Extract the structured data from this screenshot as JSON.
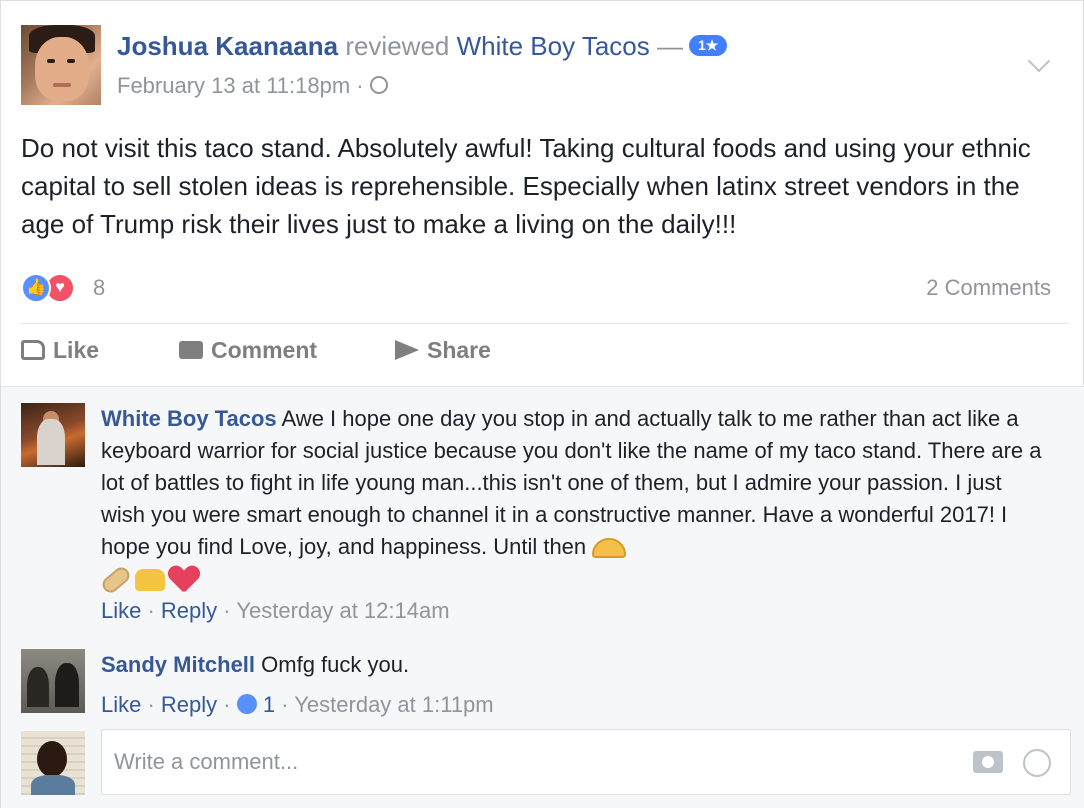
{
  "post": {
    "author": "Joshua Kaanaana",
    "action": " reviewed ",
    "page": "White Boy Tacos",
    "dash": " —",
    "rating_badge": "1★",
    "timestamp": "February 13 at 11:18pm",
    "dot": " · ",
    "text": "Do not visit this taco stand. Absolutely awful! Taking cultural foods and using your ethnic capital to sell stolen ideas is reprehensible. Especially when latinx street vendors in the age of Trump risk their lives just to make a living on the daily!!!",
    "reaction_count": "8",
    "comments_count": "2 Comments"
  },
  "actions": {
    "like": "Like",
    "comment": "Comment",
    "share": "Share"
  },
  "comments": [
    {
      "author": "White Boy Tacos",
      "text": " Awe I hope one day you stop in and actually talk to me rather than act like a keyboard warrior for social justice because you don't like the name of my taco stand. There are a lot of battles to fight in life young man...this isn't one of them, but I admire your passion. I just wish you were smart enough to channel it in a constructive manner. Have a wonderful 2017! I hope you find Love, joy, and happiness. Until then ",
      "like": "Like",
      "reply": "Reply",
      "sep": " · ",
      "time": "Yesterday at 12:14am"
    },
    {
      "author": "Sandy Mitchell",
      "text": " Omfg fuck you.",
      "like": "Like",
      "reply": "Reply",
      "sep": " · ",
      "likes": "1",
      "time": "Yesterday at 1:11pm"
    }
  ],
  "write_comment": {
    "placeholder": "Write a comment..."
  },
  "colors": {
    "link": "#365899",
    "meta": "#90949c",
    "like_blue": "#5890ff",
    "love_red": "#f25268",
    "comments_bg": "#f6f7f9"
  }
}
